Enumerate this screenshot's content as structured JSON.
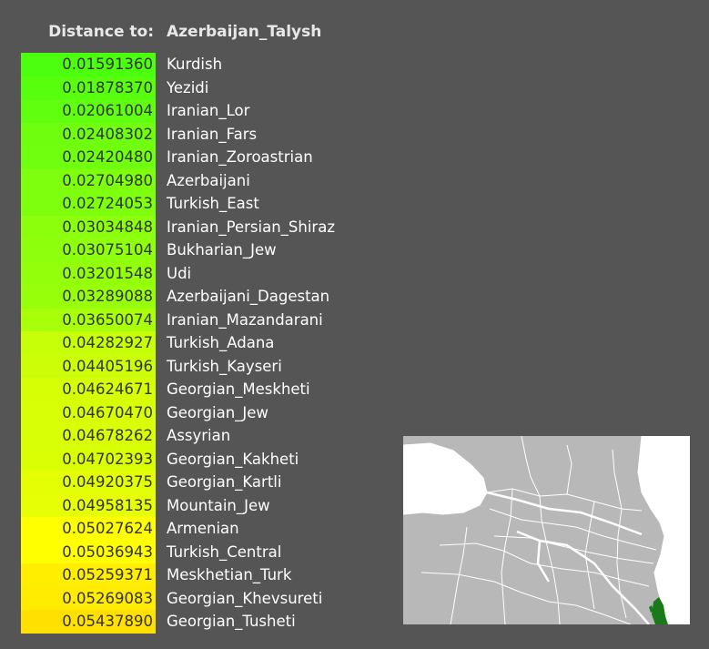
{
  "header": {
    "label": "Distance to:",
    "target": "Azerbaijan_Talysh"
  },
  "rows": [
    {
      "value": "0.01591360",
      "name": "Kurdish",
      "color": "#4cff0f"
    },
    {
      "value": "0.01878370",
      "name": "Yezidi",
      "color": "#57ff0f"
    },
    {
      "value": "0.02061004",
      "name": "Iranian_Lor",
      "color": "#5fff0f"
    },
    {
      "value": "0.02408302",
      "name": "Iranian_Fars",
      "color": "#6fff0e"
    },
    {
      "value": "0.02420480",
      "name": "Iranian_Zoroastrian",
      "color": "#70ff0e"
    },
    {
      "value": "0.02704980",
      "name": "Azerbaijani",
      "color": "#7dff0d"
    },
    {
      "value": "0.02724053",
      "name": "Turkish_East",
      "color": "#7eff0d"
    },
    {
      "value": "0.03034848",
      "name": "Iranian_Persian_Shiraz",
      "color": "#8cff0c"
    },
    {
      "value": "0.03075104",
      "name": "Bukharian_Jew",
      "color": "#8eff0c"
    },
    {
      "value": "0.03201548",
      "name": "Udi",
      "color": "#94ff0b"
    },
    {
      "value": "0.03289088",
      "name": "Azerbaijani_Dagestan",
      "color": "#98ff0b"
    },
    {
      "value": "0.03650074",
      "name": "Iranian_Mazandarani",
      "color": "#a9ff0a"
    },
    {
      "value": "0.04282927",
      "name": "Turkish_Adana",
      "color": "#c6ff08"
    },
    {
      "value": "0.04405196",
      "name": "Turkish_Kayseri",
      "color": "#ccff07"
    },
    {
      "value": "0.04624671",
      "name": "Georgian_Meskheti",
      "color": "#d6ff06"
    },
    {
      "value": "0.04670470",
      "name": "Georgian_Jew",
      "color": "#d8ff06"
    },
    {
      "value": "0.04678262",
      "name": "Assyrian",
      "color": "#d9ff06"
    },
    {
      "value": "0.04702393",
      "name": "Georgian_Kakheti",
      "color": "#daff05"
    },
    {
      "value": "0.04920375",
      "name": "Georgian_Kartli",
      "color": "#e4ff04"
    },
    {
      "value": "0.04958135",
      "name": "Mountain_Jew",
      "color": "#e6ff04"
    },
    {
      "value": "0.05027624",
      "name": "Armenian",
      "color": "#ffff00"
    },
    {
      "value": "0.05036943",
      "name": "Turkish_Central",
      "color": "#ffff00"
    },
    {
      "value": "0.05259371",
      "name": "Meskhetian_Turk",
      "color": "#ffee00"
    },
    {
      "value": "0.05269083",
      "name": "Georgian_Khevsureti",
      "color": "#ffec00"
    },
    {
      "value": "0.05437890",
      "name": "Georgian_Tusheti",
      "color": "#ffe000"
    }
  ],
  "map": {
    "land_color": "#b8b8b8",
    "sea_color": "#ffffff",
    "highlight_color": "#1a7a1a"
  }
}
